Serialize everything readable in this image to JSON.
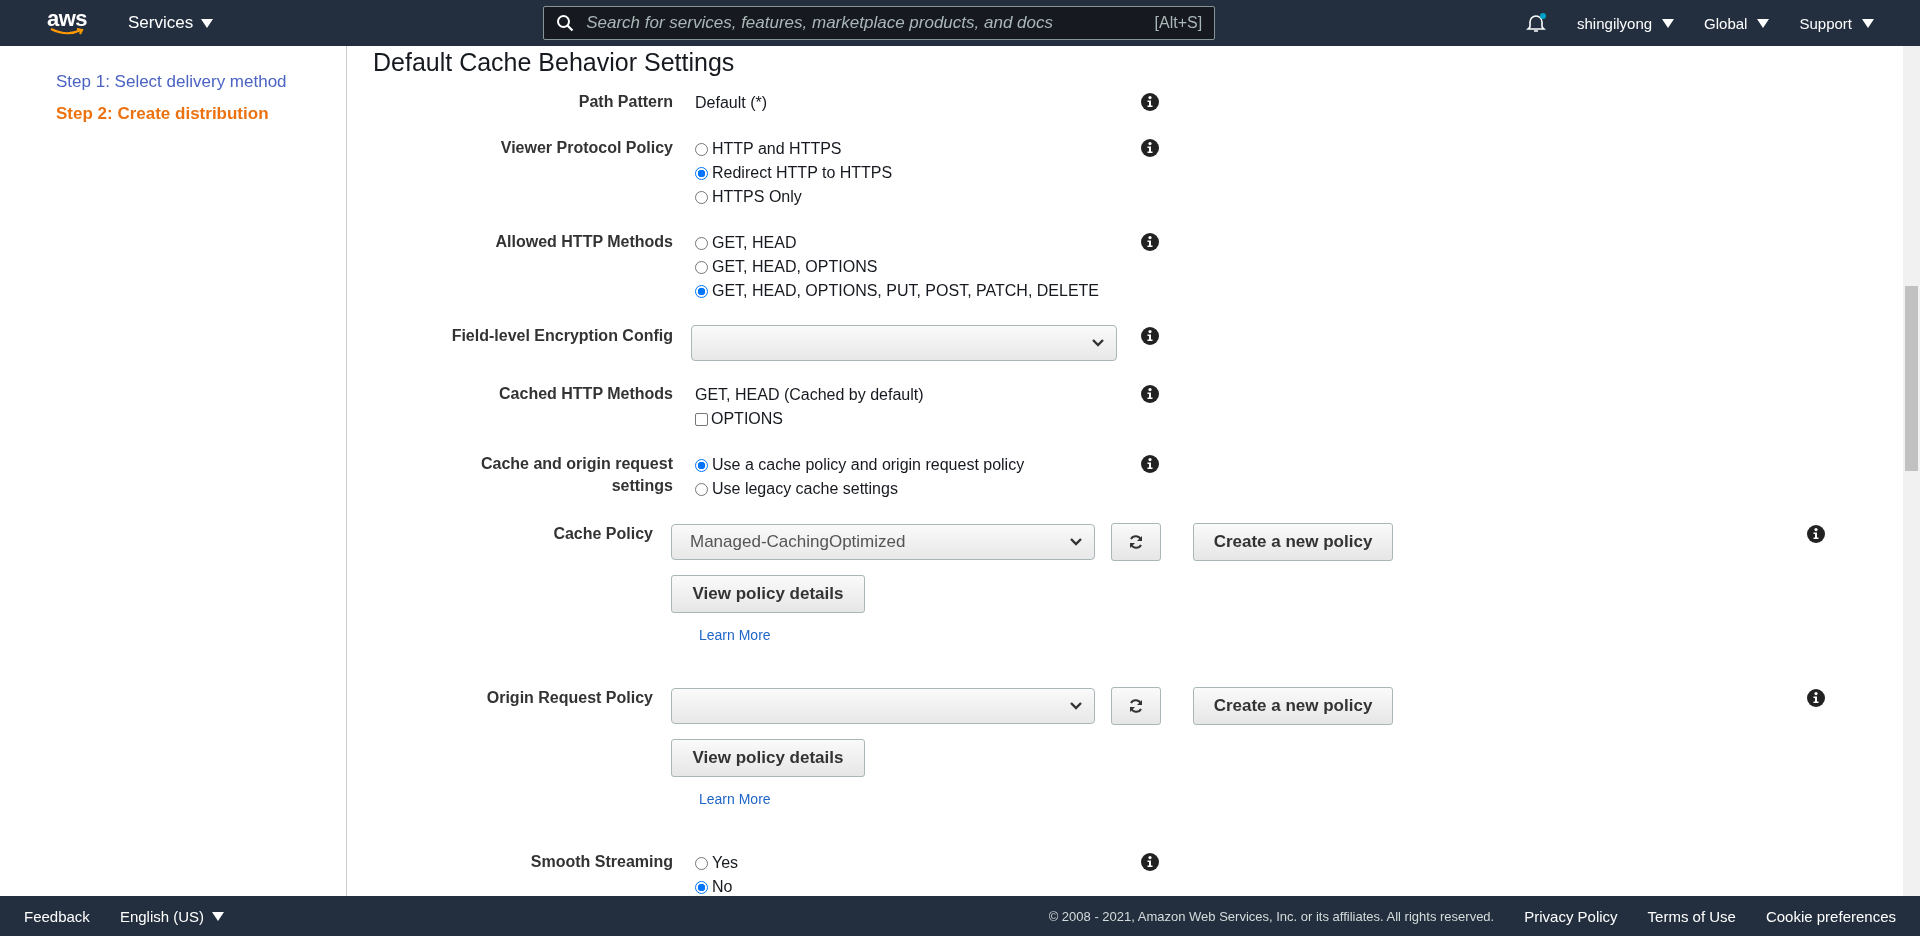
{
  "top_bar": {
    "logo": "aws",
    "services": "Services",
    "search": {
      "placeholder": "Search for services, features, marketplace products, and docs",
      "shortcut": "[Alt+S]"
    },
    "notifications": {
      "unread": true
    },
    "menus": [
      "shingilyong",
      "Global",
      "Support"
    ]
  },
  "sidebar": {
    "steps": [
      {
        "label": "Step 1: Select delivery method",
        "selected": false
      },
      {
        "label": "Step 2: Create distribution",
        "selected": true
      }
    ]
  },
  "section_title": "Default Cache Behavior Settings",
  "settings": [
    {
      "kind": "text",
      "label": "Path Pattern",
      "value": "Default (*)"
    },
    {
      "kind": "radio",
      "label": "Viewer Protocol Policy",
      "options": [
        {
          "label": "HTTP and HTTPS",
          "selected": false
        },
        {
          "label": "Redirect HTTP to HTTPS",
          "selected": true
        },
        {
          "label": "HTTPS Only",
          "selected": false
        }
      ]
    },
    {
      "kind": "radio",
      "label": "Allowed HTTP Methods",
      "options": [
        {
          "label": "GET, HEAD",
          "selected": false
        },
        {
          "label": "GET, HEAD, OPTIONS",
          "selected": false
        },
        {
          "label": "GET, HEAD, OPTIONS, PUT, POST, PATCH, DELETE",
          "selected": true
        }
      ]
    },
    {
      "kind": "select",
      "label": "Field-level Encryption Config"
    },
    {
      "kind": "checks",
      "label": "Cached HTTP Methods",
      "value": "GET, HEAD (Cached by default)",
      "options": [
        {
          "label": "OPTIONS",
          "checked": false
        }
      ]
    },
    {
      "kind": "radio",
      "label": "Cache and origin request settings",
      "options": [
        {
          "label": "Use a cache policy and origin request policy",
          "selected": true
        },
        {
          "label": "Use legacy cache settings",
          "selected": false
        }
      ]
    },
    {
      "kind": "policy",
      "label": "Cache Policy",
      "value": "Managed-CachingOptimized",
      "create": "Create a new policy",
      "details": "View policy details",
      "link": "Learn More"
    },
    {
      "kind": "policy",
      "label": "Origin Request Policy",
      "create": "Create a new policy",
      "details": "View policy details",
      "link": "Learn More"
    },
    {
      "kind": "radio",
      "label": "Smooth Streaming",
      "options": [
        {
          "label": "Yes",
          "selected": false
        },
        {
          "label": "No",
          "selected": true
        }
      ]
    }
  ],
  "footer": {
    "feedback": "Feedback",
    "language": "English (US)",
    "copyright": "© 2008 - 2021, Amazon Web Services, Inc. or its affiliates. All rights reserved.",
    "links": [
      "Privacy Policy",
      "Terms of Use",
      "Cookie preferences"
    ]
  }
}
